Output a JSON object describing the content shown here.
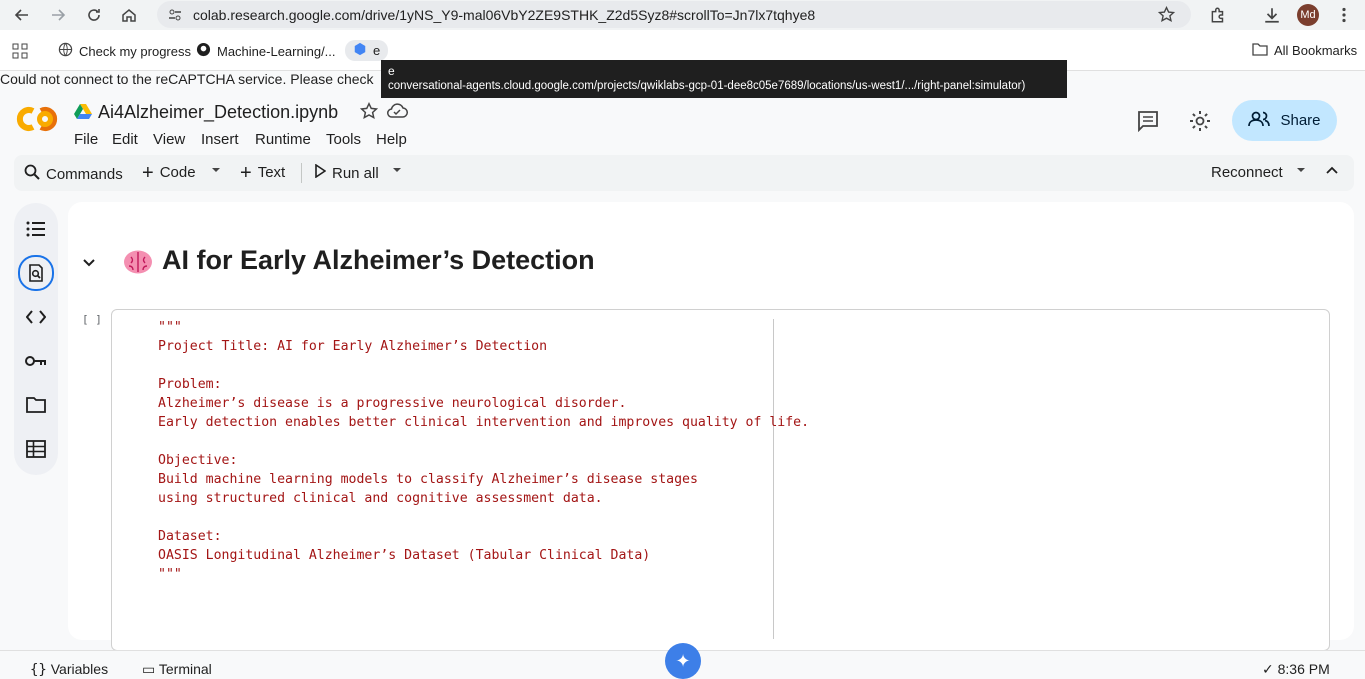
{
  "browser": {
    "url": "colab.research.google.com/drive/1yNS_Y9-mal06VbY2ZE9STHK_Z2d5Syz8#scrollTo=Jn7lx7tqhye8",
    "profile_initials": "Md",
    "bookmarks": [
      "Check my progress",
      "Machine-Learning/...",
      "e"
    ],
    "all_bookmarks_label": "All Bookmarks"
  },
  "notice": "Could not connect to the reCAPTCHA service. Please check",
  "tooltip": {
    "line1": "e",
    "line2": "conversational-agents.cloud.google.com/projects/qwiklabs-gcp-01-dee8c05e7689/locations/us-west1/.../right-panel:simulator)"
  },
  "notebook": {
    "title": "Ai4Alzheimer_Detection.ipynb",
    "menu": [
      "File",
      "Edit",
      "View",
      "Insert",
      "Runtime",
      "Tools",
      "Help"
    ],
    "share_label": "Share"
  },
  "toolbar": {
    "commands": "Commands",
    "code": "Code",
    "text": "Text",
    "run_all": "Run all",
    "reconnect": "Reconnect"
  },
  "section_heading": "AI for Early Alzheimer’s Detection",
  "cell": {
    "exec_count": "[ ]",
    "code": "\"\"\"\nProject Title: AI for Early Alzheimer’s Detection\n\nProblem:\nAlzheimer’s disease is a progressive neurological disorder.\nEarly detection enables better clinical intervention and improves quality of life.\n\nObjective:\nBuild machine learning models to classify Alzheimer’s disease stages\nusing structured clinical and cognitive assessment data.\n\nDataset:\nOASIS Longitudinal Alzheimer’s Dataset (Tabular Clinical Data)\n\"\"\""
  },
  "bottom": {
    "variables": "Variables",
    "terminal": "Terminal",
    "time": "8:36 PM"
  },
  "colors": {
    "accent": "#1a73e8",
    "share_bg": "#c2e7ff",
    "code_string": "#a31515"
  }
}
